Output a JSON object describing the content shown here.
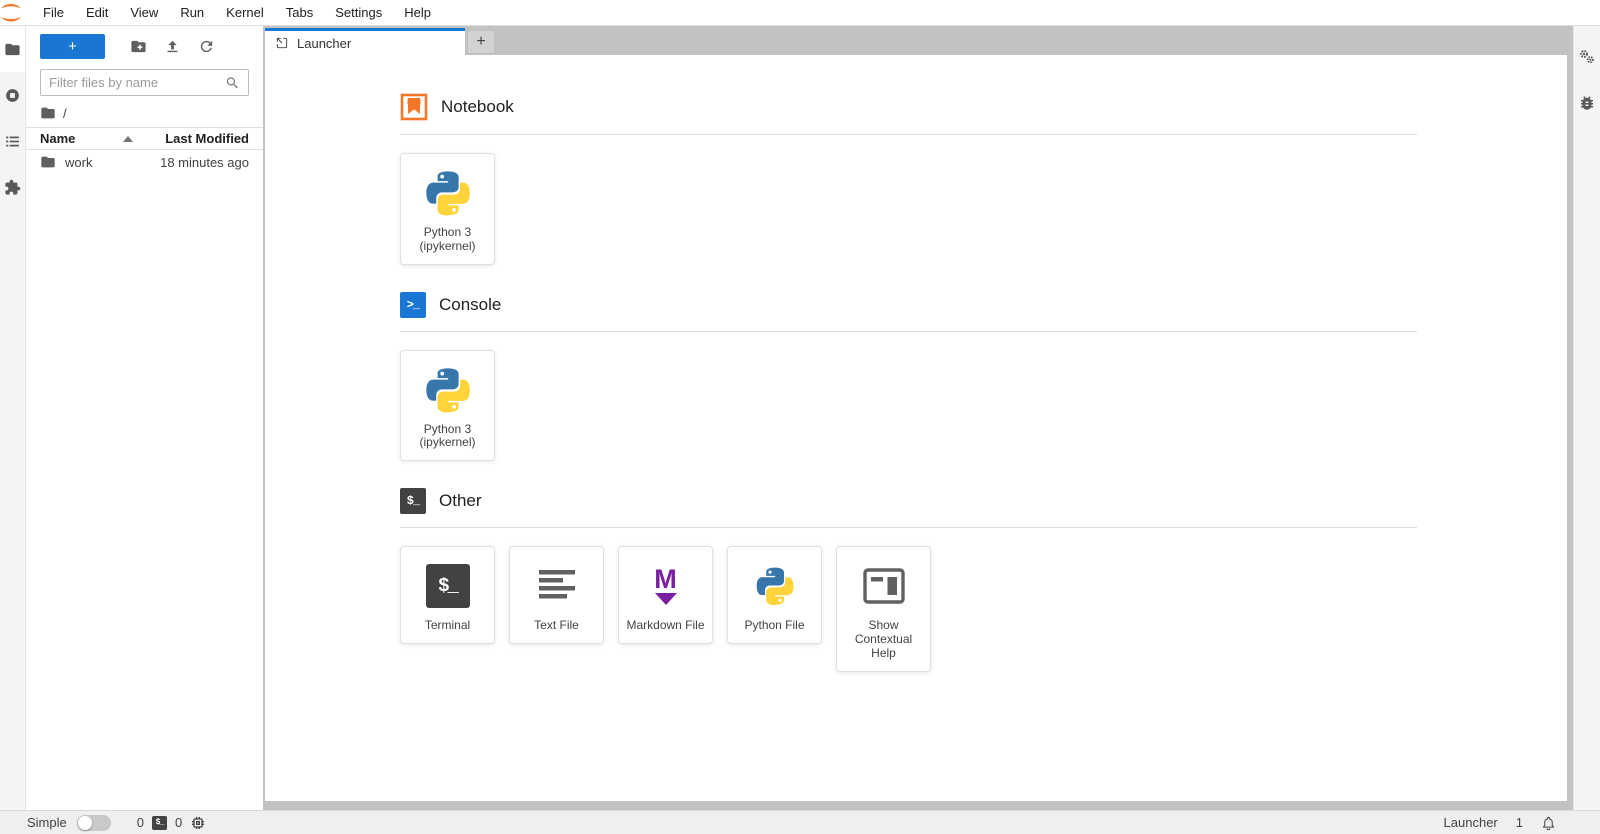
{
  "menu": {
    "items": [
      "File",
      "Edit",
      "View",
      "Run",
      "Kernel",
      "Tabs",
      "Settings",
      "Help"
    ]
  },
  "file_browser": {
    "new_launcher_label": "+",
    "filter_placeholder": "Filter files by name",
    "breadcrumb_root": "/",
    "header": {
      "name": "Name",
      "modified": "Last Modified"
    },
    "rows": [
      {
        "name": "work",
        "modified": "18 minutes ago"
      }
    ]
  },
  "tabs": {
    "launcher_label": "Launcher",
    "add_label": "+"
  },
  "launcher": {
    "sections": [
      {
        "title": "Notebook",
        "cards": [
          {
            "label": "Python 3\n(ipykernel)",
            "icon": "python-logo"
          }
        ]
      },
      {
        "title": "Console",
        "cards": [
          {
            "label": "Python 3\n(ipykernel)",
            "icon": "python-logo"
          }
        ]
      },
      {
        "title": "Other",
        "cards": [
          {
            "label": "Terminal",
            "icon": "terminal-icon"
          },
          {
            "label": "Text File",
            "icon": "text-file-icon"
          },
          {
            "label": "Markdown File",
            "icon": "markdown-icon"
          },
          {
            "label": "Python File",
            "icon": "python-logo"
          },
          {
            "label": "Show\nContextual Help",
            "icon": "contextual-help-icon"
          }
        ]
      }
    ]
  },
  "icons": {
    "console_glyph": ">_",
    "other_glyph": "$_",
    "terminal_glyph": "$_",
    "terminal_status_glyph": "$_",
    "markdown_letter": "M"
  },
  "status_bar": {
    "mode_label": "Simple",
    "terminal_count": "0",
    "kernel_count": "0",
    "context_label": "Launcher",
    "notification_count": "1"
  },
  "colors": {
    "accent_blue": "#1976d2",
    "jupyter_orange": "#f37726",
    "markdown_purple": "#7b1fa2",
    "python_blue": "#3776ab",
    "python_yellow": "#ffd43b",
    "icon_gray": "#616161"
  }
}
